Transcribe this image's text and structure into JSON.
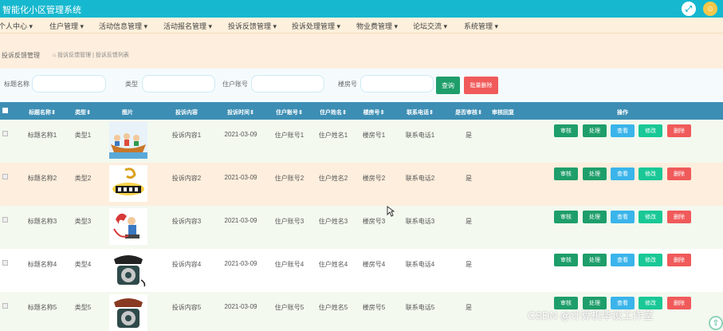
{
  "app": {
    "title": "智能化小区管理系统"
  },
  "menu": [
    {
      "label": "个人中心"
    },
    {
      "label": "住户管理"
    },
    {
      "label": "活动信息管理"
    },
    {
      "label": "活动报名管理"
    },
    {
      "label": "投诉反馈管理"
    },
    {
      "label": "投诉处理管理"
    },
    {
      "label": "物业费管理"
    },
    {
      "label": "论坛交流"
    },
    {
      "label": "系统管理"
    }
  ],
  "breadcrumb": {
    "section": "投诉反馈管理",
    "path": "投诉反馈管理 | 投诉反馈列表"
  },
  "search": {
    "title_label": "标题名称",
    "type_label": "类型",
    "account_label": "住户账号",
    "room_label": "楼房号",
    "search_btn": "查询",
    "batch_delete_btn": "批量删除"
  },
  "table": {
    "headers": {
      "title": "标题名称",
      "type": "类型",
      "image": "图片",
      "content": "投诉内容",
      "time": "投诉时间",
      "account": "住户账号",
      "name": "住户姓名",
      "room": "楼房号",
      "phone": "联系电话",
      "audited": "是否审核",
      "reply": "审核回复",
      "ops": "操作"
    },
    "actions": {
      "audit": "审核",
      "handle": "处理",
      "view": "查看",
      "edit": "修改",
      "delete": "删除"
    },
    "rows": [
      {
        "title": "标题名称1",
        "type": "类型1",
        "image": "boat-cartoon",
        "content": "投诉内容1",
        "time": "2021-03-09",
        "account": "住户账号1",
        "name": "住户姓名1",
        "room": "楼房号1",
        "phone": "联系电话1",
        "audited": "是"
      },
      {
        "title": "标题名称2",
        "type": "类型2",
        "image": "complaint-sign",
        "content": "投诉内容2",
        "time": "2021-03-09",
        "account": "住户账号2",
        "name": "住户姓名2",
        "room": "楼房号2",
        "phone": "联系电话2",
        "audited": "是"
      },
      {
        "title": "标题名称3",
        "type": "类型3",
        "image": "phone-cartoon",
        "content": "投诉内容3",
        "time": "2021-03-09",
        "account": "住户账号3",
        "name": "住户姓名3",
        "room": "楼房号3",
        "phone": "联系电话3",
        "audited": "是"
      },
      {
        "title": "标题名称4",
        "type": "类型4",
        "image": "rotary-phone",
        "content": "投诉内容4",
        "time": "2021-03-09",
        "account": "住户账号4",
        "name": "住户姓名4",
        "room": "楼房号4",
        "phone": "联系电话4",
        "audited": "是"
      },
      {
        "title": "标题名称5",
        "type": "类型5",
        "image": "rotary-phone",
        "content": "投诉内容5",
        "time": "2021-03-09",
        "account": "住户账号5",
        "name": "住户姓名5",
        "room": "楼房号5",
        "phone": "联系电话5",
        "audited": "是"
      }
    ]
  },
  "watermark": "CSDN @计算机毕设工作室",
  "colors": {
    "header": "#16b8cf",
    "table_head": "#3d8eb4",
    "row_alt": "#fdeedd",
    "row_green": "#f3f9ef"
  }
}
